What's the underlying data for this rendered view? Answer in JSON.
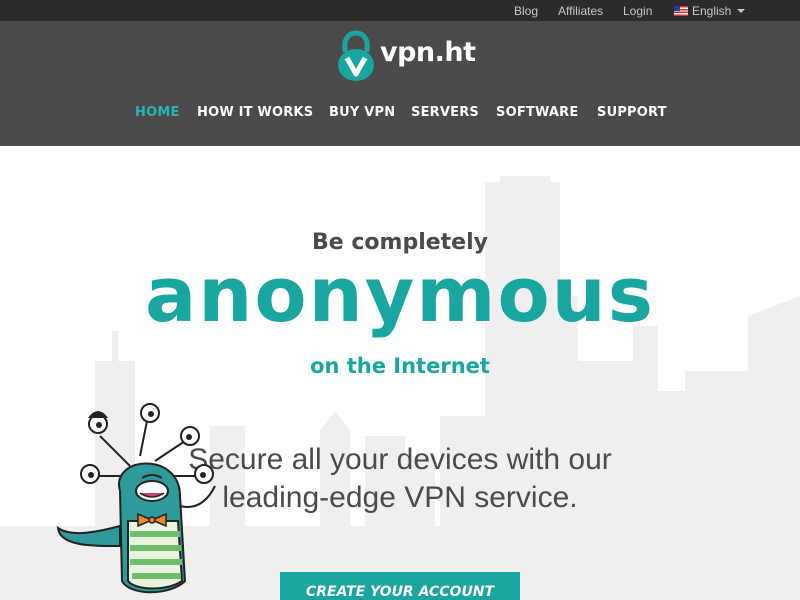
{
  "topbar": {
    "links": [
      "Blog",
      "Affiliates",
      "Login"
    ],
    "language": "English"
  },
  "brand": {
    "name": "vpn.ht",
    "accent_color": "#1aa6a0",
    "header_color": "#4a4a4a"
  },
  "nav": {
    "items": [
      "HOME",
      "HOW IT WORKS",
      "BUY VPN",
      "SERVERS",
      "SOFTWARE",
      "SUPPORT"
    ],
    "active": "HOME"
  },
  "hero": {
    "line1": "Be completely",
    "line2": "anonymous",
    "line3": "on the Internet",
    "tagline_1": "Secure all your devices with our",
    "tagline_2": "leading-edge VPN service.",
    "cta_label": "CREATE YOUR ACCOUNT"
  }
}
